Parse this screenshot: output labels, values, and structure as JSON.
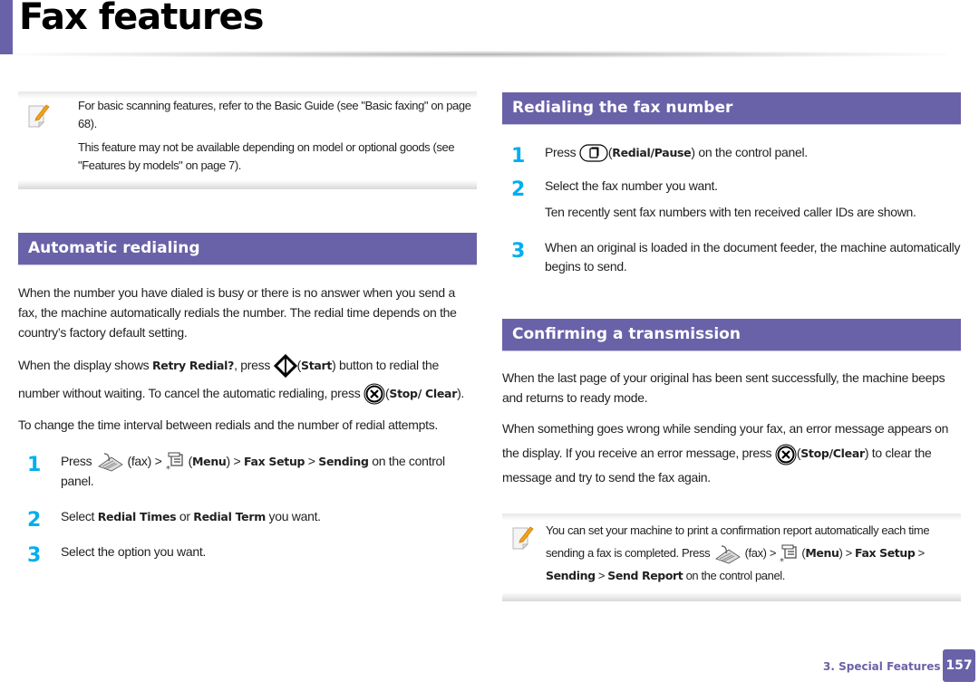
{
  "page": {
    "title": "Fax features",
    "footer_section": "3.  Special Features",
    "page_number": "157",
    "accent_color": "#6a62a8",
    "step_color": "#00aeef"
  },
  "left": {
    "note": {
      "icon": "note-pencil-icon",
      "lines": [
        "For basic scanning features, refer to the Basic Guide (see \"Basic faxing\" on page 68).",
        "This feature may not be available depending on model or optional goods (see \"Features by models\" on page 7)."
      ]
    },
    "section": {
      "title": "Automatic redialing",
      "intro": "When the number you have dialed is busy or there is no answer when you send a fax, the machine automatically redials the number. The redial time depends on the country’s factory default setting.",
      "p2": {
        "a": "When the display shows ",
        "b1": "Retry Redial?",
        "c": ", press ",
        "d": "(",
        "b2": "Start",
        "e": ") button to redial the number without waiting. To cancel the automatic redialing, press ",
        "f": "(",
        "b3": "Stop/ Clear",
        "g": ")."
      },
      "p3": "To change the time interval between redials and the number of redial attempts.",
      "steps": [
        {
          "num": "1",
          "a": "Press ",
          "fax": " (fax) > ",
          "menu_open": " (",
          "menu": "Menu",
          "menu_close": ") > ",
          "b1": "Fax Setup",
          "sep": " > ",
          "b2": "Sending",
          "tail": " on the control panel."
        },
        {
          "num": "2",
          "a": "Select ",
          "b1": "Redial Times",
          "mid": " or ",
          "b2": "Redial Term",
          "tail": " you want."
        },
        {
          "num": "3",
          "text": "Select the option you want."
        }
      ]
    }
  },
  "right": {
    "section1": {
      "title": "Redialing the fax number",
      "steps": [
        {
          "num": "1",
          "a": "Press ",
          "open": "(",
          "b1": "Redial/Pause",
          "tail": ") on the control panel."
        },
        {
          "num": "2",
          "text": "Select the fax number you want.",
          "sub": "Ten recently sent fax numbers with ten received caller IDs are shown."
        },
        {
          "num": "3",
          "text": "When an original is loaded in the document feeder, the machine automatically begins to send."
        }
      ]
    },
    "section2": {
      "title": "Confirming a transmission",
      "p1": "When the last page of your original has been sent successfully, the machine beeps and returns to ready mode.",
      "p2": {
        "a": "When something goes wrong while sending your fax, an error message appears on the display. If you receive an error message, press ",
        "open": "(",
        "b1": "Stop/Clear",
        "tail": ") to clear the message and try to send the fax again."
      },
      "note": {
        "icon": "note-pencil-icon",
        "a": "You can set your machine to print a confirmation report automatically each time sending a fax is completed. Press ",
        "fax": " (fax) > ",
        "menu_open": " (",
        "menu": "Menu",
        "menu_close": ") > ",
        "b1": "Fax Setup",
        "sep1": " > ",
        "b2": "Sending",
        "sep2": " > ",
        "b3": "Send Report",
        "tail": " on the control panel."
      }
    }
  }
}
